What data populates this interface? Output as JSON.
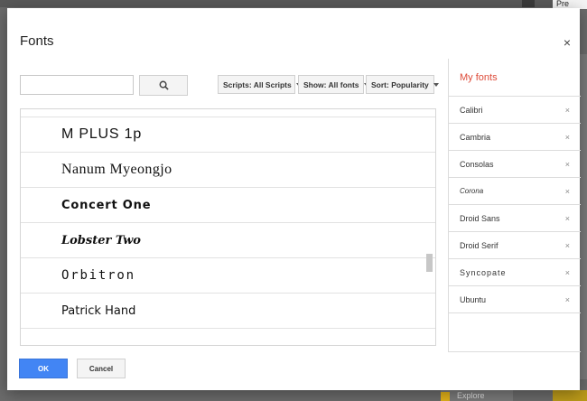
{
  "background": {
    "tab_label": "Pre",
    "explore_label": "Explore"
  },
  "dialog": {
    "title": "Fonts",
    "close_label": "×"
  },
  "search": {
    "value": "",
    "placeholder": ""
  },
  "filters": {
    "scripts": "Scripts: All Scripts",
    "show": "Show: All fonts",
    "sort": "Sort: Popularity"
  },
  "font_list": [
    "M PLUS 1p",
    "Nanum Myeongjo",
    "Concert One",
    "Lobster Two",
    "Orbitron",
    "Patrick Hand"
  ],
  "my_fonts": {
    "title": "My fonts",
    "remove_label": "×",
    "items": [
      "Calibri",
      "Cambria",
      "Consolas",
      "Corona",
      "Droid Sans",
      "Droid Serif",
      "Syncopate",
      "Ubuntu"
    ]
  },
  "buttons": {
    "ok": "OK",
    "cancel": "Cancel"
  },
  "colors": {
    "accent": "#4285f4",
    "my_fonts_title": "#dd4b39"
  }
}
